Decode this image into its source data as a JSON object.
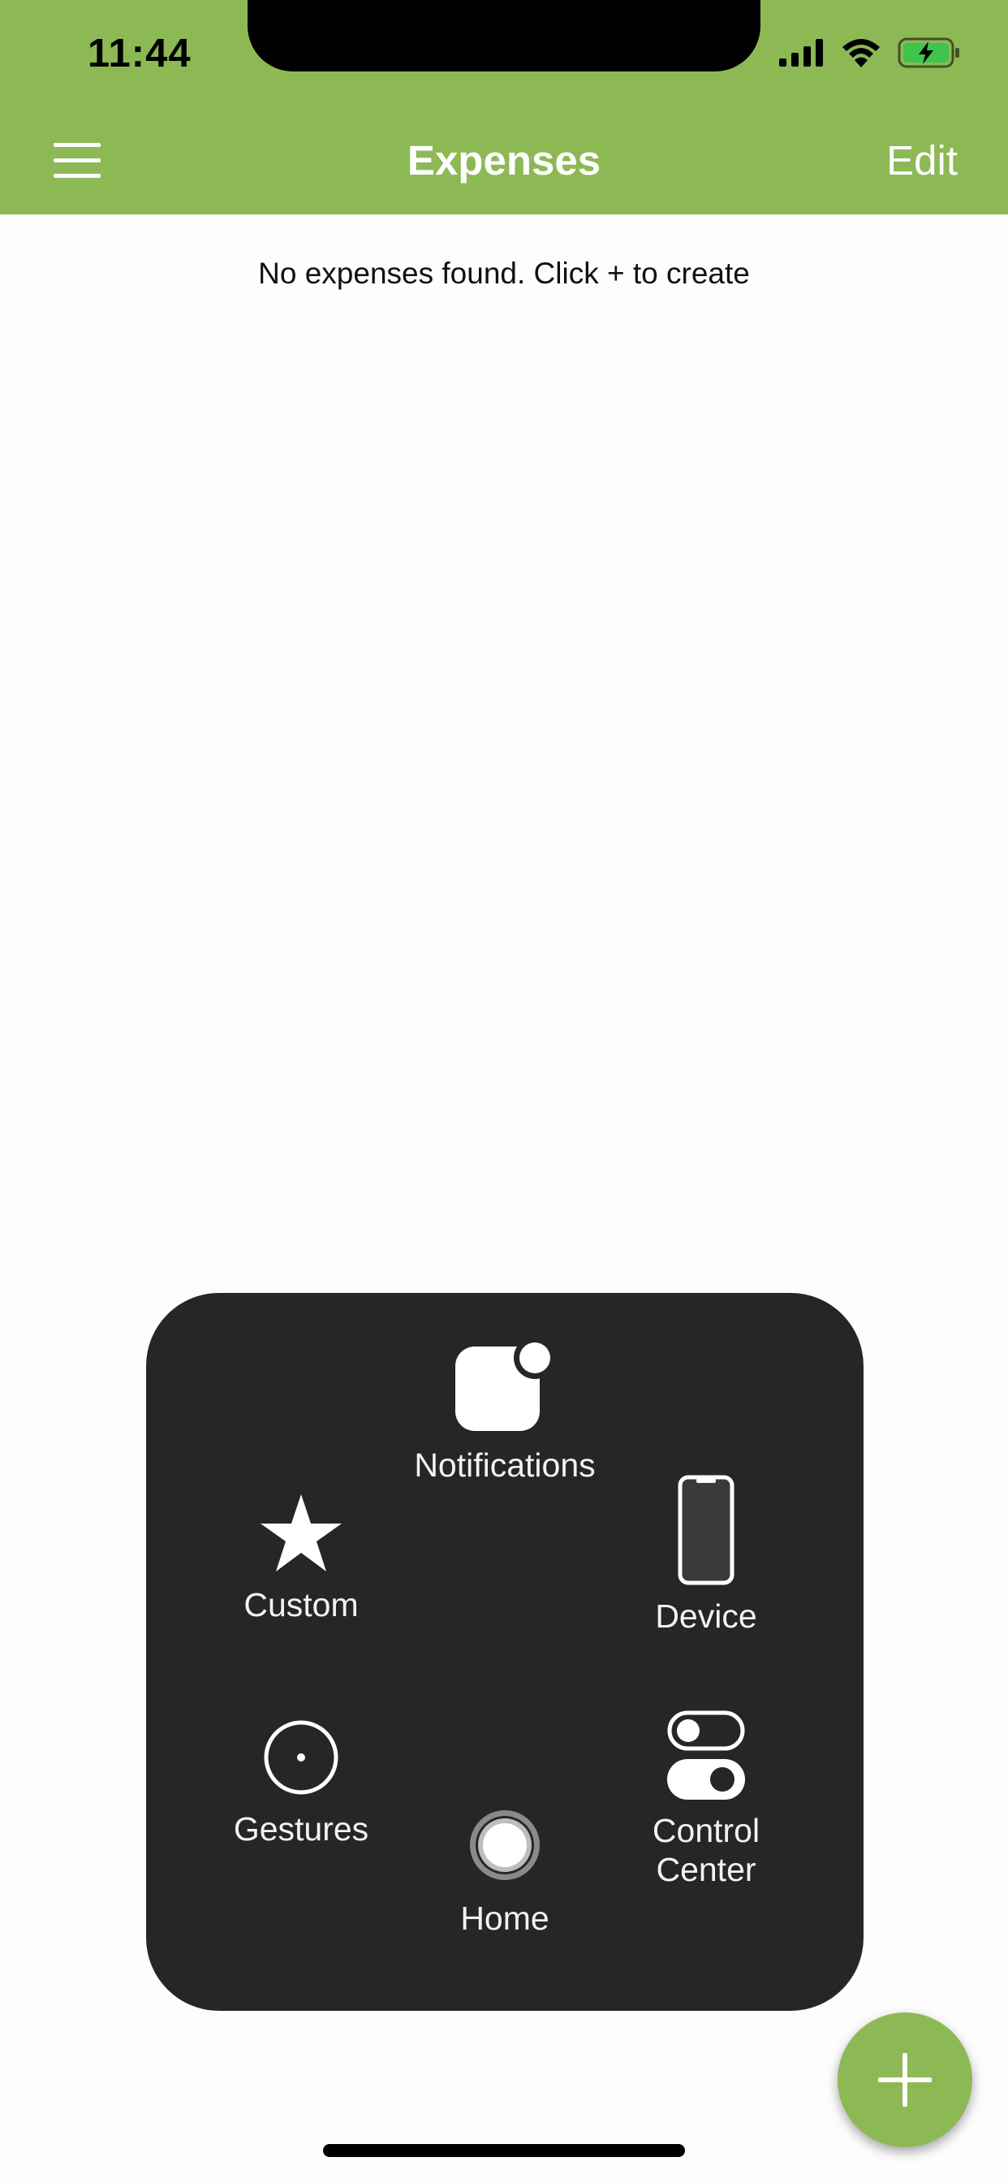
{
  "status_bar": {
    "time": "11:44",
    "icons": [
      "cellular-signal-icon",
      "wifi-icon",
      "battery-charging-icon"
    ]
  },
  "header": {
    "title": "Expenses",
    "menu_icon": "hamburger-menu-icon",
    "edit_label": "Edit"
  },
  "main": {
    "empty_message": "No expenses found. Click + to create"
  },
  "assistive_touch": {
    "items": [
      {
        "label": "Notifications",
        "icon": "notifications-icon"
      },
      {
        "label": "Custom",
        "icon": "star-icon"
      },
      {
        "label": "Device",
        "icon": "device-phone-icon"
      },
      {
        "label": "Gestures",
        "icon": "gestures-icon"
      },
      {
        "label": "Home",
        "icon": "home-button-icon"
      },
      {
        "label": "Control Center",
        "icon": "control-center-icon"
      }
    ]
  },
  "fab": {
    "icon": "plus-icon"
  },
  "colors": {
    "accent": "#8db955",
    "panel": "#262626",
    "header_text": "#ffffff"
  }
}
